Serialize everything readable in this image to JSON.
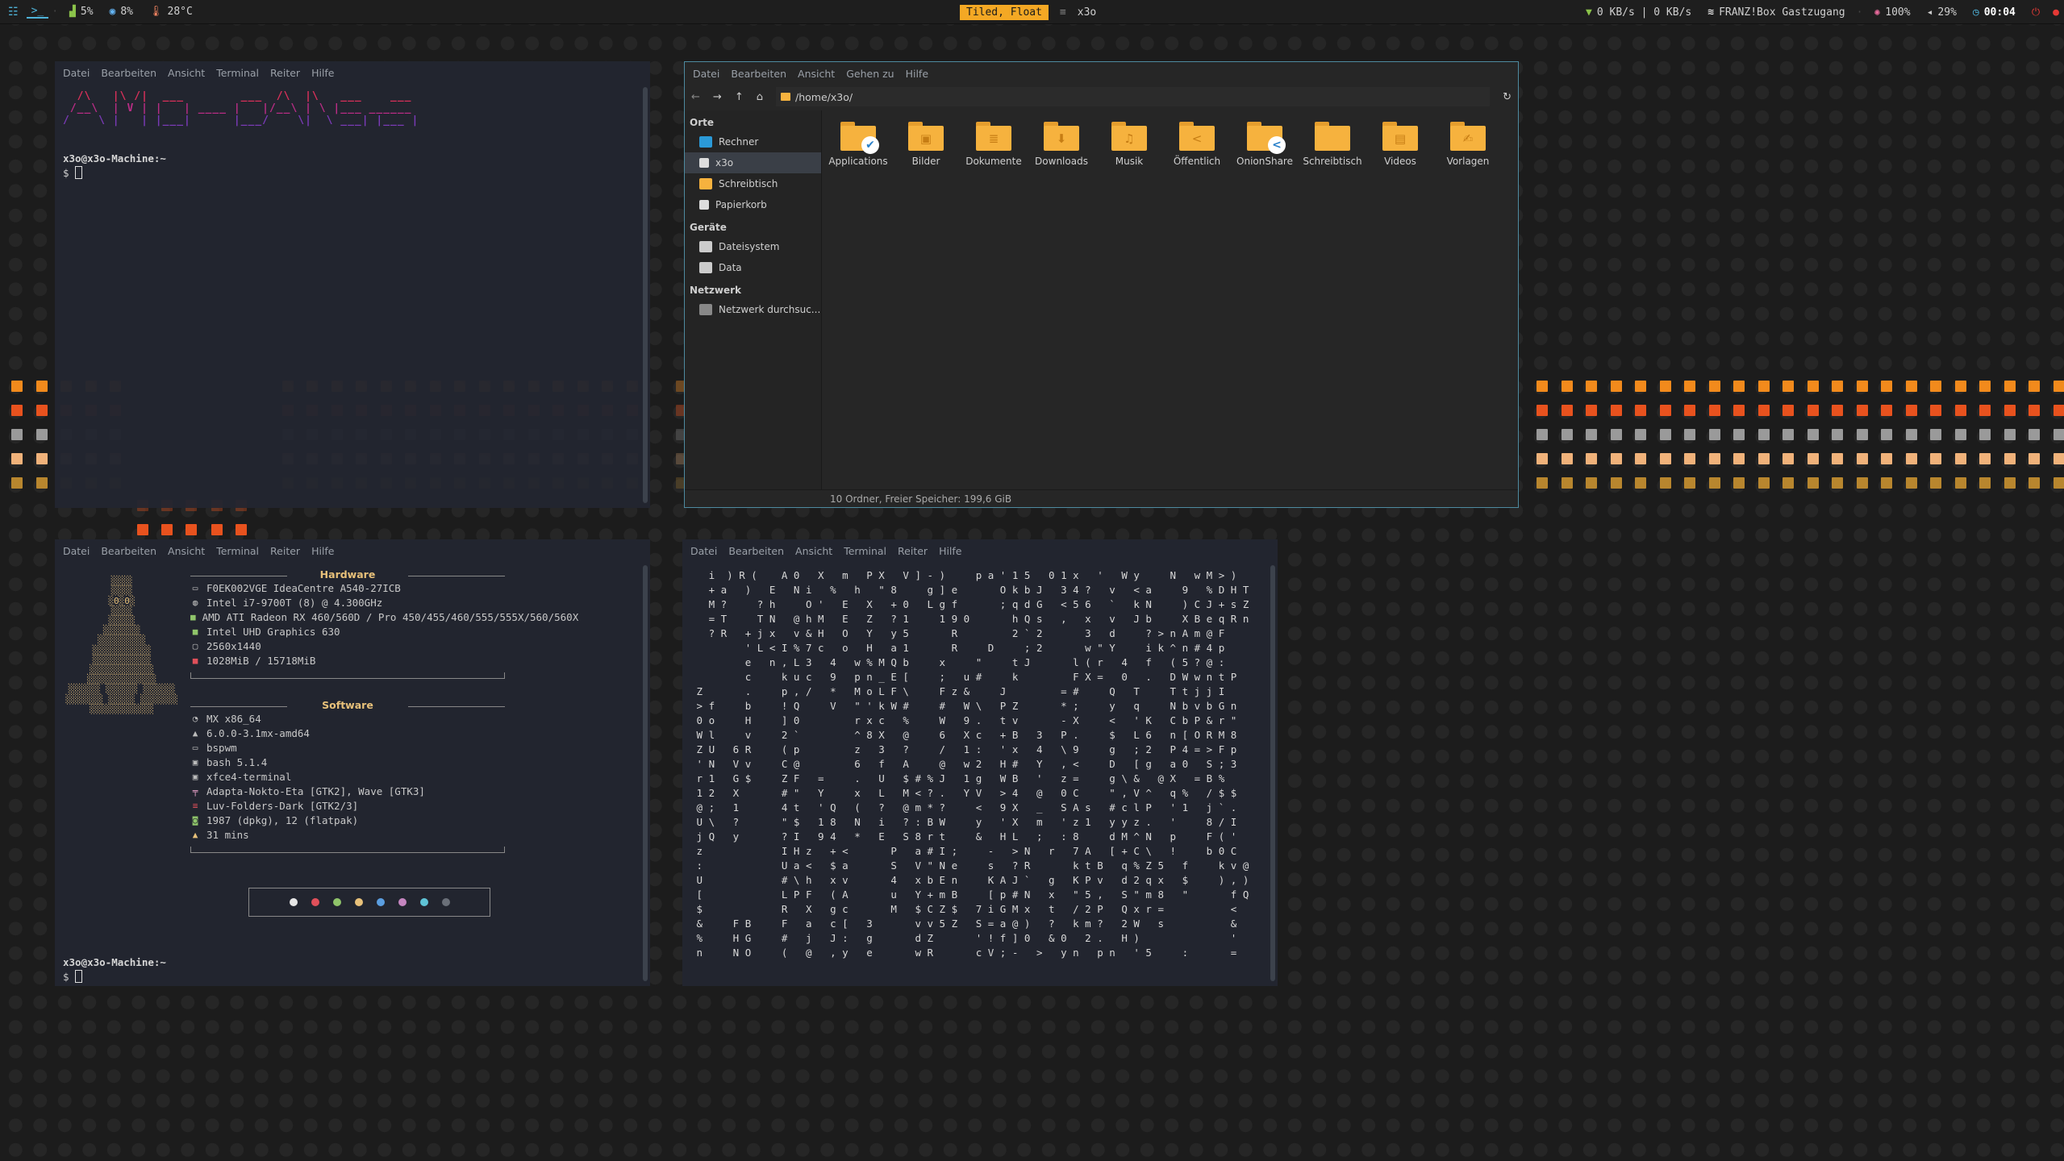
{
  "topbar": {
    "workspace_icon": "grid-icon",
    "terminal_ws": ">_",
    "cpu": "5%",
    "mem": "8%",
    "temp": "28°C",
    "layout": "Tiled, Float",
    "window_title": "x3o",
    "net": "0 KB/s | 0 KB/s",
    "wifi": "FRANZ!Box Gastzugang",
    "brightness": "100%",
    "volume": "29%",
    "time": "00:04"
  },
  "term1": {
    "menu": [
      "Datei",
      "Bearbeiten",
      "Ansicht",
      "Terminal",
      "Reiter",
      "Hilfe"
    ],
    "banner": [
      "  /\\   |\\ /|  ___        ___  /\\  |\\   ___    ___ ",
      " /__\\  | V | |   | ____ |   |/__\\ | \\ |___ ______ ",
      "/    \\ |   | |___|      |___/    \\|  \\ ___| |___ |",
      "                                                  "
    ],
    "prompt_user": "x3o@x3o-Machine:~",
    "prompt_symbol": "$"
  },
  "term2": {
    "menu": [
      "Datei",
      "Bearbeiten",
      "Ansicht",
      "Terminal",
      "Reiter",
      "Hilfe"
    ],
    "hardware_title": "Hardware",
    "hardware": [
      {
        "icon": "monitor-icon",
        "text": "F0EK002VGE IdeaCentre A540-27ICB"
      },
      {
        "icon": "cpu-icon",
        "text": "Intel i7-9700T (8) @ 4.300GHz"
      },
      {
        "icon": "gpu-icon",
        "text": "AMD ATI Radeon RX 460/560D / Pro 450/455/460/555/555X/560/560X"
      },
      {
        "icon": "gpu-icon",
        "text": "Intel UHD Graphics 630"
      },
      {
        "icon": "display-icon",
        "text": "2560x1440"
      },
      {
        "icon": "memory-icon",
        "text": "1028MiB / 15718MiB"
      }
    ],
    "software_title": "Software",
    "software": [
      {
        "icon": "os-icon",
        "text": "MX x86_64"
      },
      {
        "icon": "kernel-icon",
        "text": "6.0.0-3.1mx-amd64"
      },
      {
        "icon": "wm-icon",
        "text": "bspwm"
      },
      {
        "icon": "shell-icon",
        "text": "bash 5.1.4"
      },
      {
        "icon": "terminal-icon",
        "text": "xfce4-terminal"
      },
      {
        "icon": "theme-icon",
        "text": "Adapta-Nokto-Eta [GTK2], Wave [GTK3]"
      },
      {
        "icon": "icons-icon",
        "text": "Luv-Folders-Dark [GTK2/3]"
      },
      {
        "icon": "package-icon",
        "text": "1987 (dpkg), 12 (flatpak)"
      },
      {
        "icon": "uptime-icon",
        "text": "31 mins"
      }
    ],
    "colors": [
      "#e6e6e6",
      "#e0505a",
      "#8fc46a",
      "#e8c17a",
      "#5b9ee0",
      "#c586c0",
      "#5fc3d6",
      "#6a6f78"
    ],
    "prompt_user": "x3o@x3o-Machine:~",
    "prompt_symbol": "$"
  },
  "term3": {
    "menu": [
      "Datei",
      "Bearbeiten",
      "Ansicht",
      "Terminal",
      "Reiter",
      "Hilfe"
    ],
    "matrix": [
      "   i  ) R (    A 0   X   m   P X   V ] - )     p a ' 1 5   0 1 x   '   W y     N   w M > )",
      "   + a   )   E   N i   %   h   \" 8     g ] e       O k b J   3 4 ?   v   < a     9   % D H T",
      "   M ?     ? h     O '   E   X   + 0   L g f       ; q d G   < 5 6   `   k N     ) C J + s Z",
      "   = T     T N   @ h M   E   Z   ? 1     1 9 0       h Q s   ,   x   v   J b     X B e q R n",
      "   ? R   + j x   v & H   O   Y   y 5       R         2 ` 2       3   d     ? > n A m @ F",
      "         ' L < I % 7 c   o   H   a 1       R     D     ; 2       w \" Y     i k ^ n # 4 p",
      "         e   n , L 3   4   w % M Q b     x     \"     t J       l ( r   4   f   ( 5 ? @ :",
      "         c     k u c   9   p n _ E [     ;   u #     k         F X =   0   .   D W w n t P",
      " Z       .     p , /   *   M o L F \\     F z &     J         = #     Q   T     T t j j I",
      " > f     b     ! Q     V   \" ' k W #     #   W \\   P Z       * ;     y   q     N b v b G n",
      " 0 o     H     ] 0         r x c   %     W   9 .   t v       - X     <   ' K   C b P & r \"",
      " W l     v     2 `         ^ 8 X   @     6   X c   + B   3   P .     $   L 6   n [ O R M 8",
      " Z U   6 R     ( p         z   3   ?     /   1 :   ' x   4   \\ 9     g   ; 2   P 4 = > F p",
      " ' N   V v     C @         6   f   A     @   w 2   H #   Y   , <     D   [ g   a 0   S ; 3",
      " r 1   G $     Z F   =     .   U   $ # % J   1 g   W B   '   z =     g \\ &   @ X   = B %",
      " 1 2   X       # \"   Y     x   L   M < ? .   Y V   > 4   @   0 C     \" , V ^   q %   / $ $",
      " @ ;   1       4 t   ' Q   (   ?   @ m * ?     <   9 X   _   S A s   # c l P   ' 1   j ` .",
      " U \\   ?       \" $   1 8   N   i   ? : B W     y   ' X   m   ' z 1   y y z .   '     8 / I",
      " j Q   y       ? I   9 4   *   E   S 8 r t     &   H L   ;   : 8     d M ^ N   p     F ( '",
      " z             I H z   + <       P   a # I ;     -   > N   r   7 A   [ + C \\   !     b 0 C",
      " :             U a <   $ a       S   V \" N e     s   ? R       k t B   q % Z 5   f     k v @",
      " U             # \\ h   x v       4   x b E n     K A J `   g   K P v   d 2 q x   $     ) , )",
      " [             L P F   ( A       u   Y + m B     [ p # N   x   \" 5 ,   S \" m 8   \"       f Q",
      " $             R   X   g c       M   $ C Z $   7 i G M x   t   / 2 P   Q x r =           <",
      " &     F B     F   a   c [   3       v v 5 Z   S = a @ )   ?   k m ?   2 W   s           &",
      " %     H G     #   j   J :   g       d Z       ' ! f ] 0   & 0   2 .   H )               '",
      " n     N O     (   @   , y   e       w R       c V ; -   >   y n   p n   ' 5     :       ="
    ]
  },
  "fm": {
    "menu": [
      "Datei",
      "Bearbeiten",
      "Ansicht",
      "Gehen zu",
      "Hilfe"
    ],
    "path": "/home/x3o/",
    "sidebar": {
      "places_title": "Orte",
      "places": [
        {
          "label": "Rechner",
          "icon": "computer-icon"
        },
        {
          "label": "x3o",
          "icon": "home-icon"
        },
        {
          "label": "Schreibtisch",
          "icon": "desktop-folder-icon"
        },
        {
          "label": "Papierkorb",
          "icon": "trash-icon"
        }
      ],
      "devices_title": "Geräte",
      "devices": [
        {
          "label": "Dateisystem",
          "icon": "drive-icon"
        },
        {
          "label": "Data",
          "icon": "drive-icon"
        }
      ],
      "network_title": "Netzwerk",
      "network": [
        {
          "label": "Netzwerk durchsuc...",
          "icon": "network-icon"
        }
      ]
    },
    "folders": [
      {
        "label": "Applications",
        "emblem": "",
        "badge": "✔"
      },
      {
        "label": "Bilder",
        "emblem": "▣",
        "badge": ""
      },
      {
        "label": "Dokumente",
        "emblem": "≣",
        "badge": ""
      },
      {
        "label": "Downloads",
        "emblem": "⬇",
        "badge": ""
      },
      {
        "label": "Musik",
        "emblem": "♫",
        "badge": ""
      },
      {
        "label": "Öffentlich",
        "emblem": "<",
        "badge": ""
      },
      {
        "label": "OnionShare",
        "emblem": "",
        "badge": "<"
      },
      {
        "label": "Schreibtisch",
        "emblem": "",
        "badge": ""
      },
      {
        "label": "Videos",
        "emblem": "▤",
        "badge": ""
      },
      {
        "label": "Vorlagen",
        "emblem": "✍",
        "badge": ""
      }
    ],
    "status": "10 Ordner, Freier Speicher: 199,6 GiB"
  },
  "visualizer_colors": {
    "row1": "#f28a1c",
    "row2": "#e8521e",
    "row3": "#9a9a9a",
    "row4": "#f0b27a",
    "row5": "#b8862e"
  }
}
